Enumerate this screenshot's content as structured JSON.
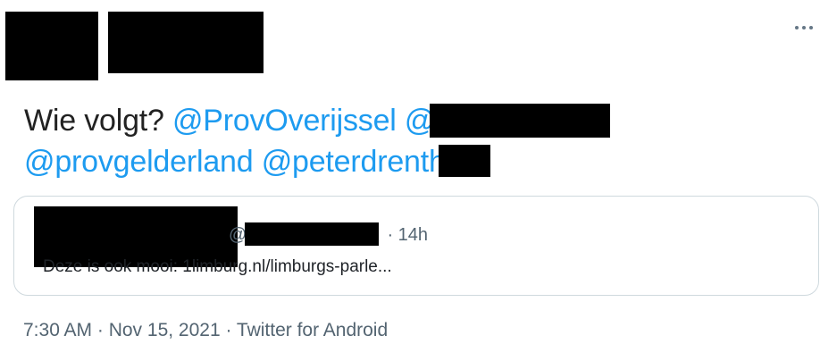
{
  "tweet": {
    "text_prefix": "Wie volgt? ",
    "mention_1": "@ProvOverijssel",
    "mention_2_partial": "@",
    "mention_3": "@provgelderland",
    "mention_4_partial": "@peterdrenth"
  },
  "quoted_tweet": {
    "handle_at": "@",
    "time_sep": "· 14h",
    "text": "Deze is ook mooi: 1limburg.nl/limburgs-parle..."
  },
  "meta": {
    "line": "7:30 AM · Nov 15, 2021 · Twitter for Android"
  },
  "icons": {
    "more": "more-horizontal-icon"
  },
  "colors": {
    "mention": "#1d9bf0",
    "secondary_text": "#536471",
    "border": "#cfd9de"
  }
}
